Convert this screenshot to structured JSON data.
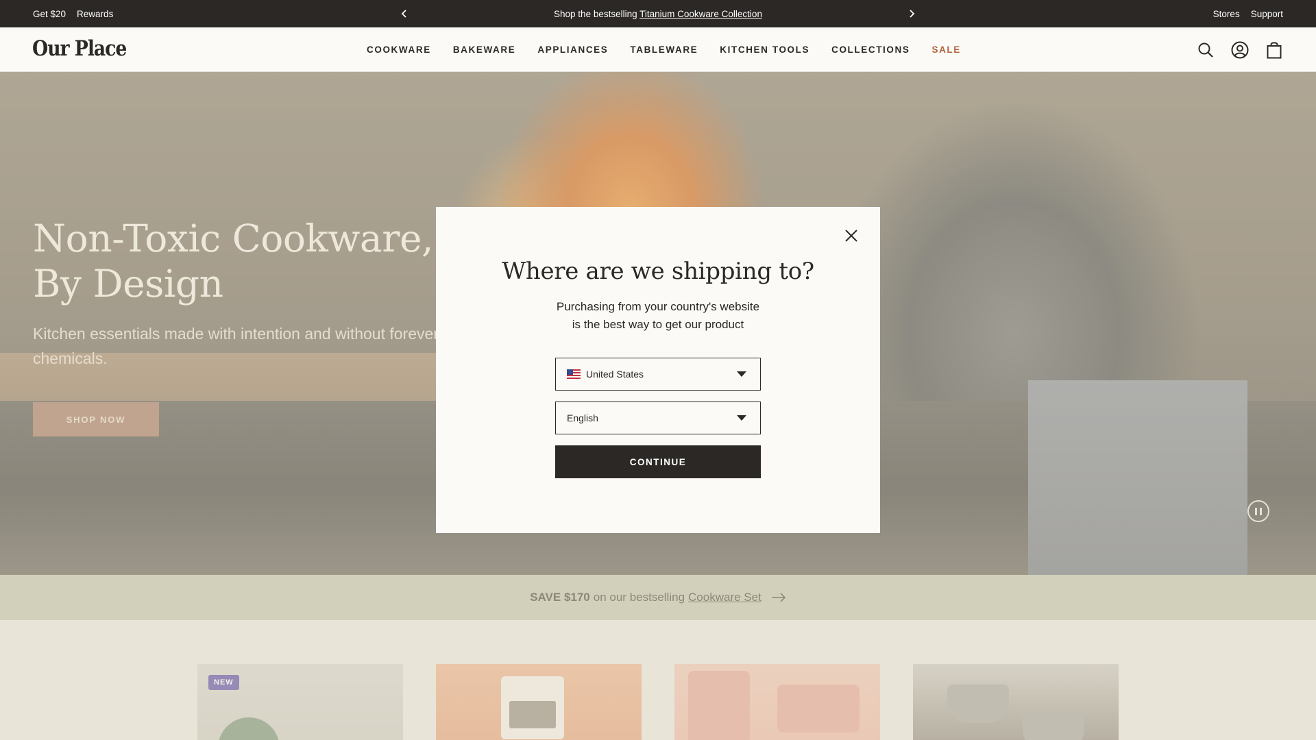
{
  "announcement": {
    "get_label": "Get $20",
    "rewards_label": "Rewards",
    "message_prefix": "Shop the bestselling ",
    "message_link": "Titanium Cookware Collection",
    "stores_label": "Stores",
    "support_label": "Support"
  },
  "header": {
    "logo": "Our Place",
    "nav": [
      {
        "label": "COOKWARE"
      },
      {
        "label": "BAKEWARE"
      },
      {
        "label": "APPLIANCES"
      },
      {
        "label": "TABLEWARE"
      },
      {
        "label": "KITCHEN TOOLS"
      },
      {
        "label": "COLLECTIONS"
      },
      {
        "label": "SALE"
      }
    ],
    "icons": [
      "search-icon",
      "account-icon",
      "cart-icon"
    ]
  },
  "hero": {
    "title_line1": "Non-Toxic Cookware,",
    "title_line2": "By Design",
    "subtitle": "Kitchen essentials made with intention and without forever chemicals.",
    "cta": "SHOP NOW"
  },
  "promo": {
    "bold": "SAVE $170",
    "text": "on our bestselling",
    "link": "Cookware Set"
  },
  "products": [
    {
      "badge": "NEW"
    }
  ],
  "modal": {
    "title": "Where are we shipping to?",
    "desc_line1": "Purchasing from your country's website",
    "desc_line2": "is the best way to get our product",
    "country": "United States",
    "language": "English",
    "continue": "CONTINUE"
  },
  "colors": {
    "dark": "#2b2826",
    "sale": "#b0643d",
    "promo_bg": "#c7c7ad",
    "modal_bg": "#fbfaf7",
    "badge": "#5f4ea5"
  }
}
